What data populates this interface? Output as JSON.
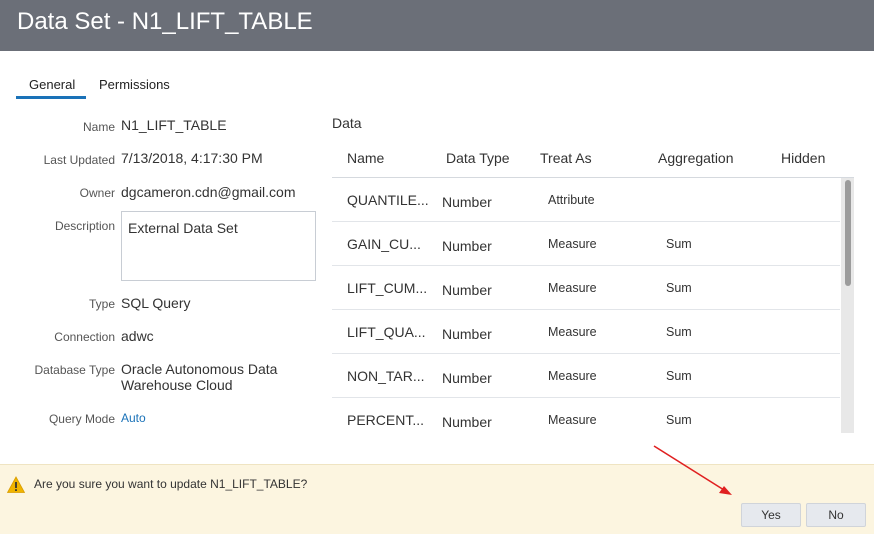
{
  "dialog": {
    "title": "Data Set - N1_LIFT_TABLE"
  },
  "tabs": [
    {
      "label": "General",
      "active": true
    },
    {
      "label": "Permissions",
      "active": false
    }
  ],
  "properties": {
    "name": {
      "label": "Name",
      "value": "N1_LIFT_TABLE"
    },
    "last_updated": {
      "label": "Last Updated",
      "value": "7/13/2018, 4:17:30 PM"
    },
    "owner": {
      "label": "Owner",
      "value": "dgcameron.cdn@gmail.com"
    },
    "description": {
      "label": "Description",
      "value": "External Data Set"
    },
    "type": {
      "label": "Type",
      "value": "SQL Query"
    },
    "connection": {
      "label": "Connection",
      "value": "adwc"
    },
    "database_type": {
      "label": "Database Type",
      "value": "Oracle Autonomous Data Warehouse Cloud"
    },
    "query_mode": {
      "label": "Query Mode",
      "value": "Auto"
    }
  },
  "data_table": {
    "title": "Data",
    "columns": [
      "Name",
      "Data Type",
      "Treat As",
      "Aggregation",
      "Hidden"
    ],
    "rows": [
      {
        "name": "QUANTILE...",
        "data_type": "Number",
        "treat_as": "Attribute",
        "aggregation": ""
      },
      {
        "name": "GAIN_CU...",
        "data_type": "Number",
        "treat_as": "Measure",
        "aggregation": "Sum"
      },
      {
        "name": "LIFT_CUM...",
        "data_type": "Number",
        "treat_as": "Measure",
        "aggregation": "Sum"
      },
      {
        "name": "LIFT_QUA...",
        "data_type": "Number",
        "treat_as": "Measure",
        "aggregation": "Sum"
      },
      {
        "name": "NON_TAR...",
        "data_type": "Number",
        "treat_as": "Measure",
        "aggregation": "Sum"
      },
      {
        "name": "PERCENT...",
        "data_type": "Number",
        "treat_as": "Measure",
        "aggregation": "Sum"
      }
    ]
  },
  "confirm": {
    "message": "Are you sure you want to update N1_LIFT_TABLE?",
    "yes_label": "Yes",
    "no_label": "No"
  },
  "colors": {
    "titlebar": "#6b6f78",
    "accent": "#1a72b8",
    "confirm_bg": "#fcf5e0",
    "warning": "#f0b400",
    "annotation_arrow": "#e02020"
  },
  "icons": {
    "warning": "warning-triangle-icon"
  }
}
